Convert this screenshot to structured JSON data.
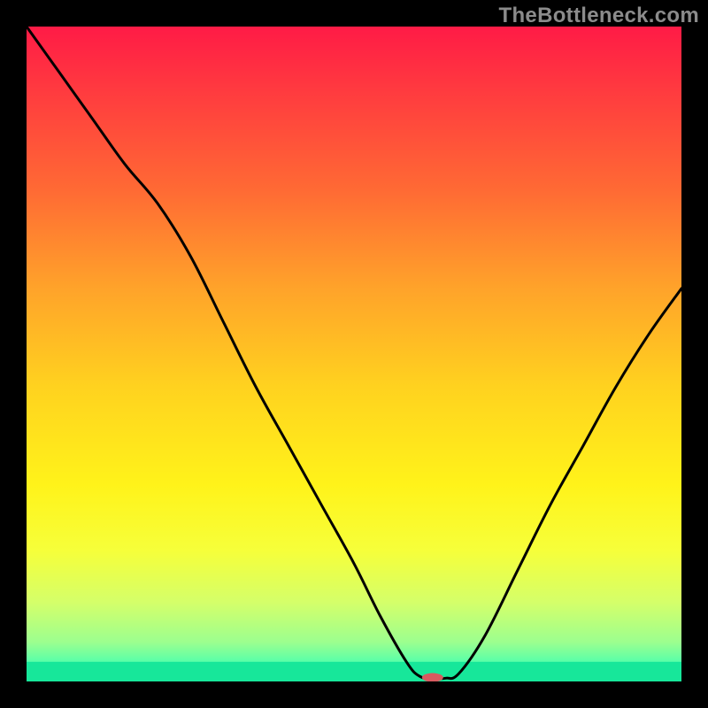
{
  "watermark": "TheBottleneck.com",
  "chart_data": {
    "type": "line",
    "title": "",
    "xlabel": "",
    "ylabel": "",
    "xlim": [
      0,
      100
    ],
    "ylim": [
      0,
      100
    ],
    "x": [
      0,
      5,
      10,
      15,
      20,
      25,
      30,
      35,
      40,
      45,
      50,
      54,
      58,
      60,
      62,
      64,
      66,
      70,
      75,
      80,
      85,
      90,
      95,
      100
    ],
    "values": [
      100,
      93,
      86,
      79,
      73,
      65,
      55,
      45,
      36,
      27,
      18,
      10,
      3,
      0.8,
      0.5,
      0.5,
      1.2,
      7,
      17,
      27,
      36,
      45,
      53,
      60
    ],
    "bottom_green_band": {
      "y0": 0,
      "y1": 3.0
    },
    "marker": {
      "x": 62,
      "y": 0.6,
      "color": "#d75a5f",
      "rx": 12,
      "ry": 5
    },
    "gradient_stops": [
      {
        "offset": 0.0,
        "color": "#ff1b46"
      },
      {
        "offset": 0.1,
        "color": "#ff3b3f"
      },
      {
        "offset": 0.25,
        "color": "#ff6a34"
      },
      {
        "offset": 0.4,
        "color": "#ffa32a"
      },
      {
        "offset": 0.55,
        "color": "#ffd21f"
      },
      {
        "offset": 0.7,
        "color": "#fff31a"
      },
      {
        "offset": 0.8,
        "color": "#f6ff3a"
      },
      {
        "offset": 0.88,
        "color": "#d4ff6a"
      },
      {
        "offset": 0.94,
        "color": "#9cff8f"
      },
      {
        "offset": 0.975,
        "color": "#4dffad"
      },
      {
        "offset": 1.0,
        "color": "#15e99a"
      }
    ]
  }
}
